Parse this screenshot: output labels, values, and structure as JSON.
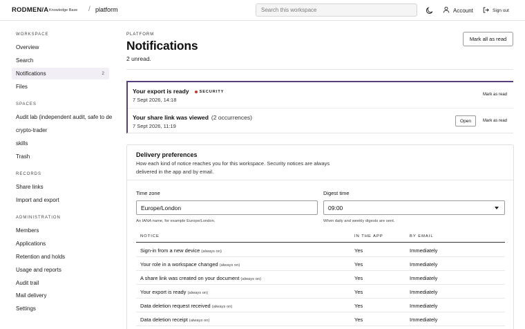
{
  "topbar": {
    "brand": "RODMEN/A",
    "brand_sub": "Knowledge Base",
    "separator": "/",
    "workspace": "platform",
    "search_placeholder": "Search this workspace",
    "theme_icon": "moon-icon",
    "account_label": "Account",
    "account_icon": "user-icon",
    "signout_label": "Sign out",
    "signout_icon": "sign-out-icon"
  },
  "sidebar": {
    "workspace_heading": "WORKSPACE",
    "workspace_items": [
      {
        "label": "Overview"
      },
      {
        "label": "Search"
      },
      {
        "label": "Notifications",
        "badge": "2",
        "active": true
      },
      {
        "label": "Files"
      }
    ],
    "spaces_heading": "SPACES",
    "spaces_items": [
      {
        "label": "Audit lab (independent audit, safe to de"
      },
      {
        "label": "crypto-trader"
      },
      {
        "label": "skills"
      },
      {
        "label": "Trash"
      }
    ],
    "records_heading": "RECORDS",
    "records_items": [
      {
        "label": "Share links"
      },
      {
        "label": "Import and export"
      }
    ],
    "admin_heading": "ADMINISTRATION",
    "admin_items": [
      {
        "label": "Members"
      },
      {
        "label": "Applications"
      },
      {
        "label": "Retention and holds"
      },
      {
        "label": "Usage and reports"
      },
      {
        "label": "Audit trail"
      },
      {
        "label": "Mail delivery"
      },
      {
        "label": "Settings"
      }
    ]
  },
  "main": {
    "eyebrow": "PLATFORM",
    "title": "Notifications",
    "unread": "2 unread.",
    "mark_all_label": "Mark all as read"
  },
  "notifications": [
    {
      "title": "Your export is ready",
      "tag": "SECURITY",
      "time": "7 Sept 2026, 14:18",
      "mark_label": "Mark as read"
    },
    {
      "title": "Your share link was viewed",
      "extra": "(2 occurrences)",
      "time": "7 Sept 2026, 11:19",
      "open_label": "Open",
      "mark_label": "Mark as read"
    }
  ],
  "preferences": {
    "title": "Delivery preferences",
    "description": "How each kind of notice reaches you for this workspace. Security notices are always delivered in the app and by email.",
    "timezone_label": "Time zone",
    "timezone_value": "Europe/London",
    "timezone_hint": "An IANA name, for example Europe/London.",
    "digest_label": "Digest time",
    "digest_value": "09:00",
    "digest_hint": "When daily and weekly digests are sent.",
    "columns": [
      "NOTICE",
      "IN THE APP",
      "BY EMAIL"
    ],
    "rows": [
      {
        "notice": "Sign-in from a new device",
        "note": "(always on)",
        "app": "Yes",
        "email": "Immediately"
      },
      {
        "notice": "Your role in a workspace changed",
        "note": "(always on)",
        "app": "Yes",
        "email": "Immediately"
      },
      {
        "notice": "A share link was created on your document",
        "note": "(always on)",
        "app": "Yes",
        "email": "Immediately"
      },
      {
        "notice": "Your export is ready",
        "note": "(always on)",
        "app": "Yes",
        "email": "Immediately"
      },
      {
        "notice": "Data deletion request received",
        "note": "(always on)",
        "app": "Yes",
        "email": "Immediately"
      },
      {
        "notice": "Data deletion receipt",
        "note": "(always on)",
        "app": "Yes",
        "email": "Immediately"
      }
    ]
  }
}
